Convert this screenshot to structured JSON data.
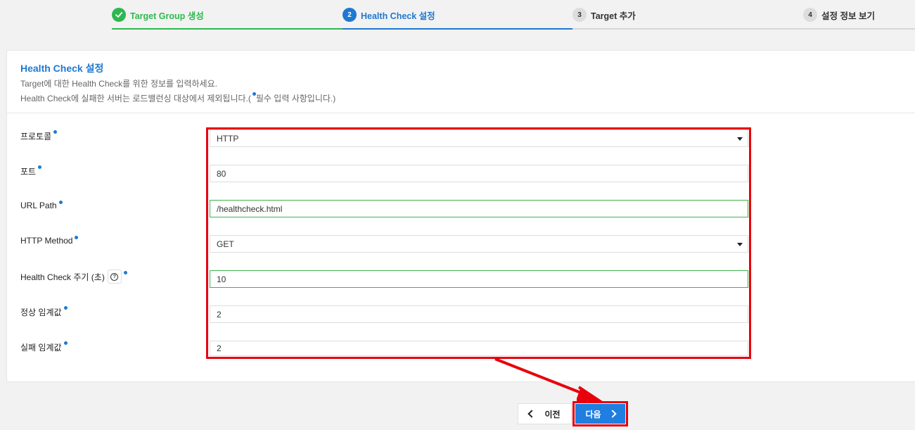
{
  "stepper": {
    "steps": [
      {
        "number": "",
        "label": "Target Group 생성",
        "state": "done"
      },
      {
        "number": "2",
        "label": "Health Check 설정",
        "state": "active"
      },
      {
        "number": "3",
        "label": "Target 추가",
        "state": "todo"
      },
      {
        "number": "4",
        "label": "설정 정보 보기",
        "state": "todo"
      }
    ]
  },
  "panel": {
    "title": "Health Check 설정",
    "desc_line1": "Target에 대한 Health Check를 위한 정보를 입력하세요.",
    "desc_line2_before": "Health Check에 실패한 서버는 로드밸런싱 대상에서 제외됩니다.(",
    "desc_line2_after": "필수 입력 사항입니다.)"
  },
  "form": {
    "protocol": {
      "label": "프로토콜",
      "value": "HTTP"
    },
    "port": {
      "label": "포트",
      "value": "80"
    },
    "url_path": {
      "label": "URL Path",
      "value": "/healthcheck.html"
    },
    "http_method": {
      "label": "HTTP Method",
      "value": "GET"
    },
    "interval": {
      "label": "Health Check 주기 (초)",
      "value": "10",
      "help_glyph": "?"
    },
    "healthy_threshold": {
      "label": "정상 임계값",
      "value": "2"
    },
    "unhealthy_threshold": {
      "label": "실패 임계값",
      "value": "2"
    }
  },
  "buttons": {
    "prev_label": "이전",
    "next_label": "다음"
  },
  "colors": {
    "accent": "#1f78d1",
    "success": "#2eb84f",
    "highlight": "#e8000c",
    "next_button": "#1f7ee0"
  },
  "icons": [
    "check-icon",
    "caret-down-icon",
    "help-icon",
    "chevron-left-icon",
    "chevron-right-icon",
    "annotation-arrow-icon"
  ]
}
